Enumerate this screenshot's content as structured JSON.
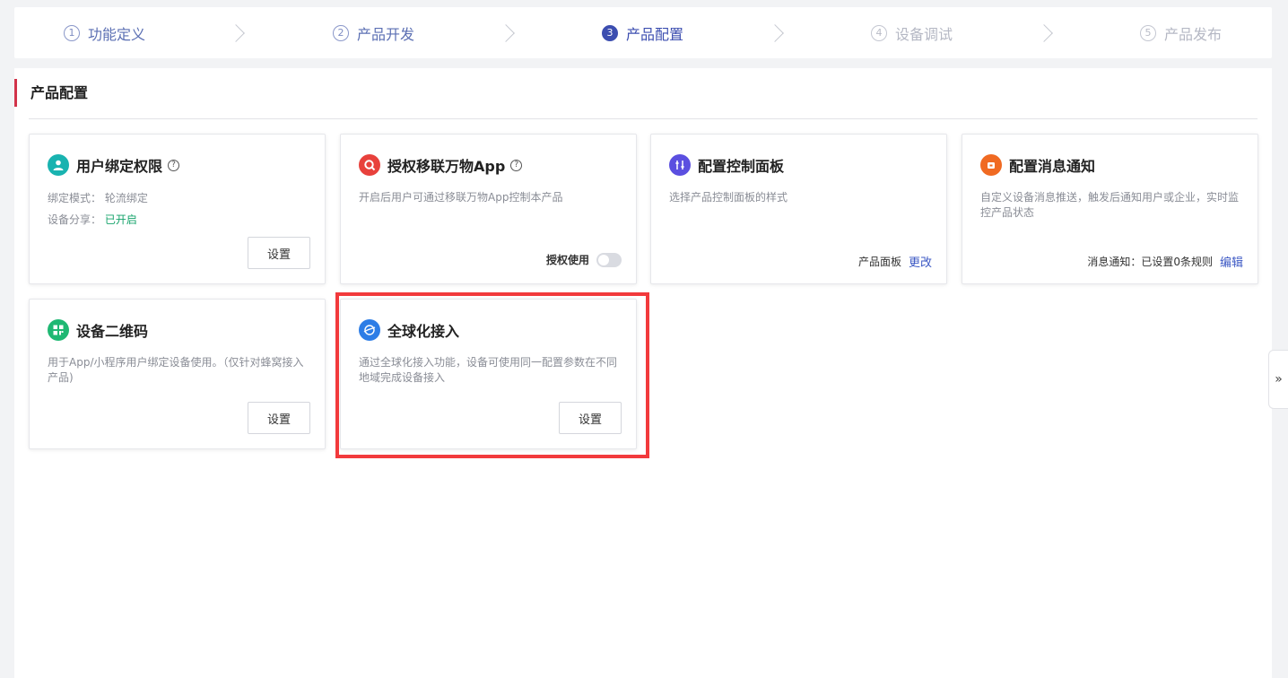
{
  "steps": [
    {
      "num": "1",
      "label": "功能定义",
      "state": "done"
    },
    {
      "num": "2",
      "label": "产品开发",
      "state": "done"
    },
    {
      "num": "3",
      "label": "产品配置",
      "state": "active"
    },
    {
      "num": "4",
      "label": "设备调试",
      "state": "future"
    },
    {
      "num": "5",
      "label": "产品发布",
      "state": "future"
    }
  ],
  "section": {
    "title": "产品配置"
  },
  "cards": {
    "binding": {
      "title": "用户绑定权限",
      "mode_label": "绑定模式：",
      "mode_value": "轮流绑定",
      "share_label": "设备分享：",
      "share_value": "已开启",
      "button": "设置",
      "icon_color": "#19b3b0"
    },
    "app_auth": {
      "title": "授权移联万物App",
      "desc": "开启后用户可通过移联万物App控制本产品",
      "toggle_label": "授权使用",
      "icon_color": "#e8413c"
    },
    "panel": {
      "title": "配置控制面板",
      "desc": "选择产品控制面板的样式",
      "foot_label": "产品面板",
      "foot_link": "更改",
      "icon_color": "#5b4fe0"
    },
    "notify": {
      "title": "配置消息通知",
      "desc": "自定义设备消息推送，触发后通知用户或企业，实时监控产品状态",
      "foot_label": "消息通知：已设置0条规则",
      "foot_link": "编辑",
      "icon_color": "#f06a22"
    },
    "qrcode": {
      "title": "设备二维码",
      "desc": "用于App/小程序用户绑定设备使用。（仅针对蜂窝接入产品)",
      "button": "设置",
      "icon_color": "#1fb873"
    },
    "global": {
      "title": "全球化接入",
      "desc": "通过全球化接入功能，设备可使用同一配置参数在不同地域完成设备接入",
      "button": "设置",
      "icon_color": "#2d7de6"
    }
  },
  "side_tab": {
    "label": "»"
  },
  "colors": {
    "accent": "#3c4eb0",
    "highlight": "#f23a3c",
    "section_bar": "#d2334a"
  }
}
